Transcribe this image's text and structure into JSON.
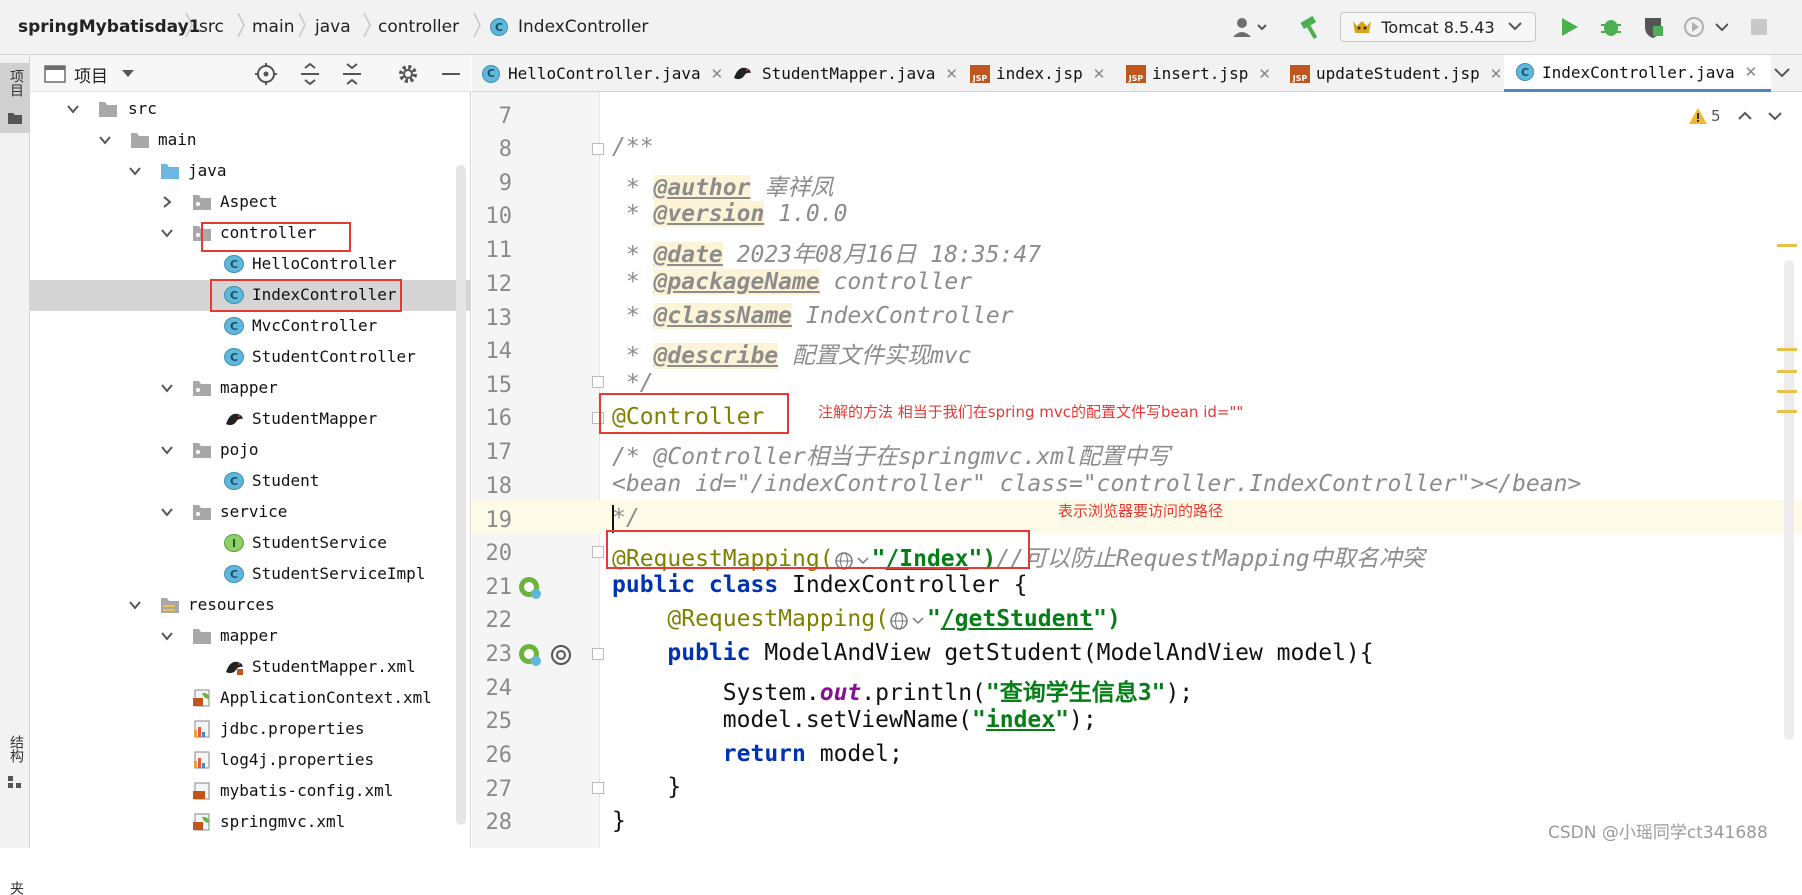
{
  "breadcrumb": {
    "project": "springMybatisday1",
    "items": [
      "src",
      "main",
      "java",
      "controller",
      "IndexController"
    ]
  },
  "toolbar": {
    "run_config": "Tomcat 8.5.43"
  },
  "left_stripe": {
    "top_label": "项目",
    "bottom_label": "结构",
    "bottom_label2": "夹"
  },
  "project_panel": {
    "title": "项目",
    "tree": [
      {
        "label": "src",
        "type": "folder",
        "expanded": true
      },
      {
        "label": "main",
        "type": "folder",
        "expanded": true
      },
      {
        "label": "java",
        "type": "folder-blue",
        "expanded": true
      },
      {
        "label": "Aspect",
        "type": "package",
        "expanded": false
      },
      {
        "label": "controller",
        "type": "package",
        "expanded": true
      },
      {
        "label": "HelloController",
        "type": "class"
      },
      {
        "label": "IndexController",
        "type": "class",
        "selected": true
      },
      {
        "label": "MvcController",
        "type": "class"
      },
      {
        "label": "StudentController",
        "type": "class"
      },
      {
        "label": "mapper",
        "type": "package",
        "expanded": true
      },
      {
        "label": "StudentMapper",
        "type": "mybatis"
      },
      {
        "label": "pojo",
        "type": "package",
        "expanded": true
      },
      {
        "label": "Student",
        "type": "class"
      },
      {
        "label": "service",
        "type": "package",
        "expanded": true
      },
      {
        "label": "StudentService",
        "type": "interface"
      },
      {
        "label": "StudentServiceImpl",
        "type": "class"
      },
      {
        "label": "resources",
        "type": "folder",
        "expanded": true
      },
      {
        "label": "mapper",
        "type": "package",
        "expanded": true
      },
      {
        "label": "StudentMapper.xml",
        "type": "mybatis"
      },
      {
        "label": "ApplicationContext.xml",
        "type": "spring-xml"
      },
      {
        "label": "jdbc.properties",
        "type": "properties"
      },
      {
        "label": "log4j.properties",
        "type": "properties"
      },
      {
        "label": "mybatis-config.xml",
        "type": "xml"
      },
      {
        "label": "springmvc.xml",
        "type": "spring-xml"
      }
    ]
  },
  "tabs": [
    {
      "label": "HelloController.java",
      "icon": "class"
    },
    {
      "label": "StudentMapper.java",
      "icon": "mybatis"
    },
    {
      "label": "index.jsp",
      "icon": "jsp"
    },
    {
      "label": "insert.jsp",
      "icon": "jsp"
    },
    {
      "label": "updateStudent.jsp",
      "icon": "jsp"
    },
    {
      "label": "IndexController.java",
      "icon": "class",
      "active": true
    }
  ],
  "tab_icons": {
    "jsp_text": "JSP",
    "class_letter": "C",
    "interface_letter": "I",
    "close": "✕"
  },
  "inspections": {
    "warnings": "5"
  },
  "editor": {
    "line_numbers": [
      "7",
      "8",
      "9",
      "10",
      "11",
      "12",
      "13",
      "14",
      "15",
      "16",
      "17",
      "18",
      "19",
      "20",
      "21",
      "22",
      "23",
      "24",
      "25",
      "26",
      "27",
      "28"
    ],
    "l8": "/**",
    "l9_star": " * ",
    "l9_tag": "@author",
    "l9_val": " 辜祥凤",
    "l10_star": " * ",
    "l10_tag": "@version",
    "l10_val": " 1.0.0",
    "l11_star": " * ",
    "l11_tag": "@date",
    "l11_val": " 2023年08月16日 18:35:47",
    "l12_star": " * ",
    "l12_tag": "@packageName",
    "l12_val": " controller",
    "l13_star": " * ",
    "l13_tag": "@className",
    "l13_val": " IndexController",
    "l14_star": " * ",
    "l14_tag": "@describe",
    "l14_val": " 配置文件实现mvc",
    "l15": " */",
    "l16": "@Controller",
    "l17": "/* @Controller相当于在springmvc.xml配置中写",
    "l18": "<bean id=\"/indexController\" class=\"controller.IndexController\"></bean>",
    "l19": "*/",
    "l20_anno": "@RequestMapping(",
    "l20_q1": "\"",
    "l20_str": "/Index",
    "l20_q2": "\")",
    "l20_cm": "//可以防止RequestMapping中取名冲突",
    "l21_kw": "public class",
    "l21_rest": " IndexController {",
    "l22_anno": "    @RequestMapping(",
    "l22_q1": "\"",
    "l22_str": "/getStudent",
    "l22_q2": "\")",
    "l23_kw": "    public",
    "l23_rest": " ModelAndView getStudent(ModelAndView model){",
    "l24_a": "        System.",
    "l24_fld": "out",
    "l24_b": ".println(",
    "l24_str": "\"查询学生信息3\"",
    "l24_c": ");",
    "l25_a": "        model.setViewName(",
    "l25_q1": "\"",
    "l25_str": "index",
    "l25_q2": "\"",
    "l25_c": ");",
    "l26_kw": "        return",
    "l26_rest": " model;",
    "l27": "    }",
    "l28": "}"
  },
  "annotations": {
    "note1": "注解的方法 相当于我们在spring mvc的配置文件写bean id=\"\"",
    "note2": "表示浏览器要访问的路径"
  },
  "watermark": "CSDN @小瑶同学ct341688",
  "colors": {
    "accent": "#4a86c8",
    "highlight_box": "#e53935",
    "keyword": "#0033b3",
    "string": "#067d17",
    "annotation": "#808000",
    "comment": "#8c8c8c"
  }
}
